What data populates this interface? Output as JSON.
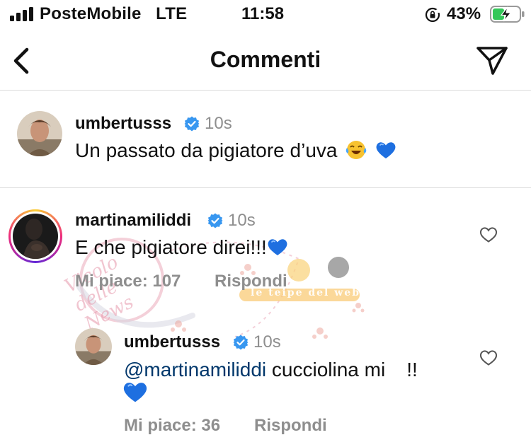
{
  "status_bar": {
    "carrier": "PosteMobile",
    "network": "LTE",
    "time": "11:58",
    "battery": "43%"
  },
  "header": {
    "title": "Commenti"
  },
  "caption": {
    "username": "umbertusss",
    "time": "10s",
    "text": "Un passato da pigiatore d’uva"
  },
  "comments": [
    {
      "username": "martinamiliddi",
      "time": "10s",
      "text": "E che pigiatore direi!!!",
      "likes_label": "Mi piace: 107",
      "reply_label": "Rispondi"
    },
    {
      "username": "umbertusss",
      "time": "10s",
      "mention": "@martinamiliddi",
      "text": " cucciolina mi",
      "text_end": "!!",
      "likes_label": "Mi piace: 36",
      "reply_label": "Rispondi"
    }
  ],
  "watermark": {
    "script_text": "Vicolo delle News",
    "badge_text": "le teipe del web"
  },
  "colors": {
    "verified": "#3897f0",
    "mention": "#00376b",
    "muted": "#8e8e8e",
    "battery_fill": "#34c759",
    "heart_emoji": "#1e6fe0",
    "story_ring": [
      "#f9ce34",
      "#ee2a7b",
      "#6228d7"
    ]
  },
  "icons": {
    "back": "chevron-left-icon",
    "share": "paper-plane-icon",
    "like": "heart-outline-icon",
    "verified": "verified-badge-icon",
    "lock": "rotation-lock-icon",
    "battery": "battery-charging-icon"
  }
}
